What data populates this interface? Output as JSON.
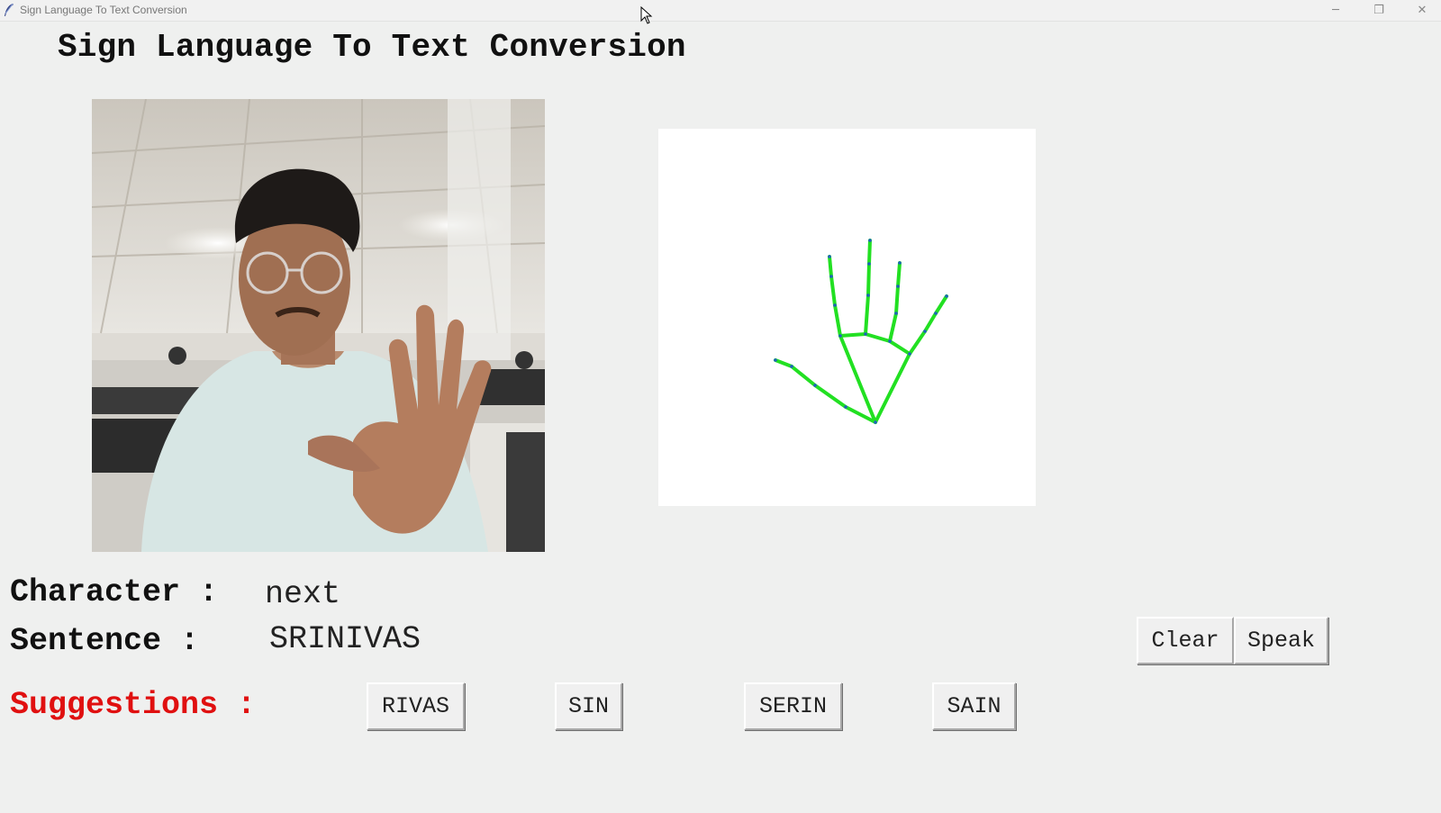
{
  "window": {
    "title": "Sign Language To Text Conversion",
    "controls": {
      "minimize": "─",
      "maximize": "❐",
      "close": "✕"
    }
  },
  "heading": "Sign Language To Text Conversion",
  "character": {
    "label": "Character :",
    "value": "next"
  },
  "sentence": {
    "label": "Sentence :",
    "value": "SRINIVAS"
  },
  "suggestions": {
    "label": "Suggestions :",
    "items": [
      "RIVAS",
      "SIN",
      "SERIN",
      "SAIN"
    ]
  },
  "actions": {
    "clear": "Clear",
    "speak": "Speak"
  },
  "colors": {
    "skeleton_line": "#22e022",
    "skeleton_joint": "#2060c0",
    "suggestions_label": "#e01010",
    "background": "#eff0ef"
  },
  "icons": {
    "app": "feather-icon",
    "cursor": "mouse-pointer-icon"
  }
}
